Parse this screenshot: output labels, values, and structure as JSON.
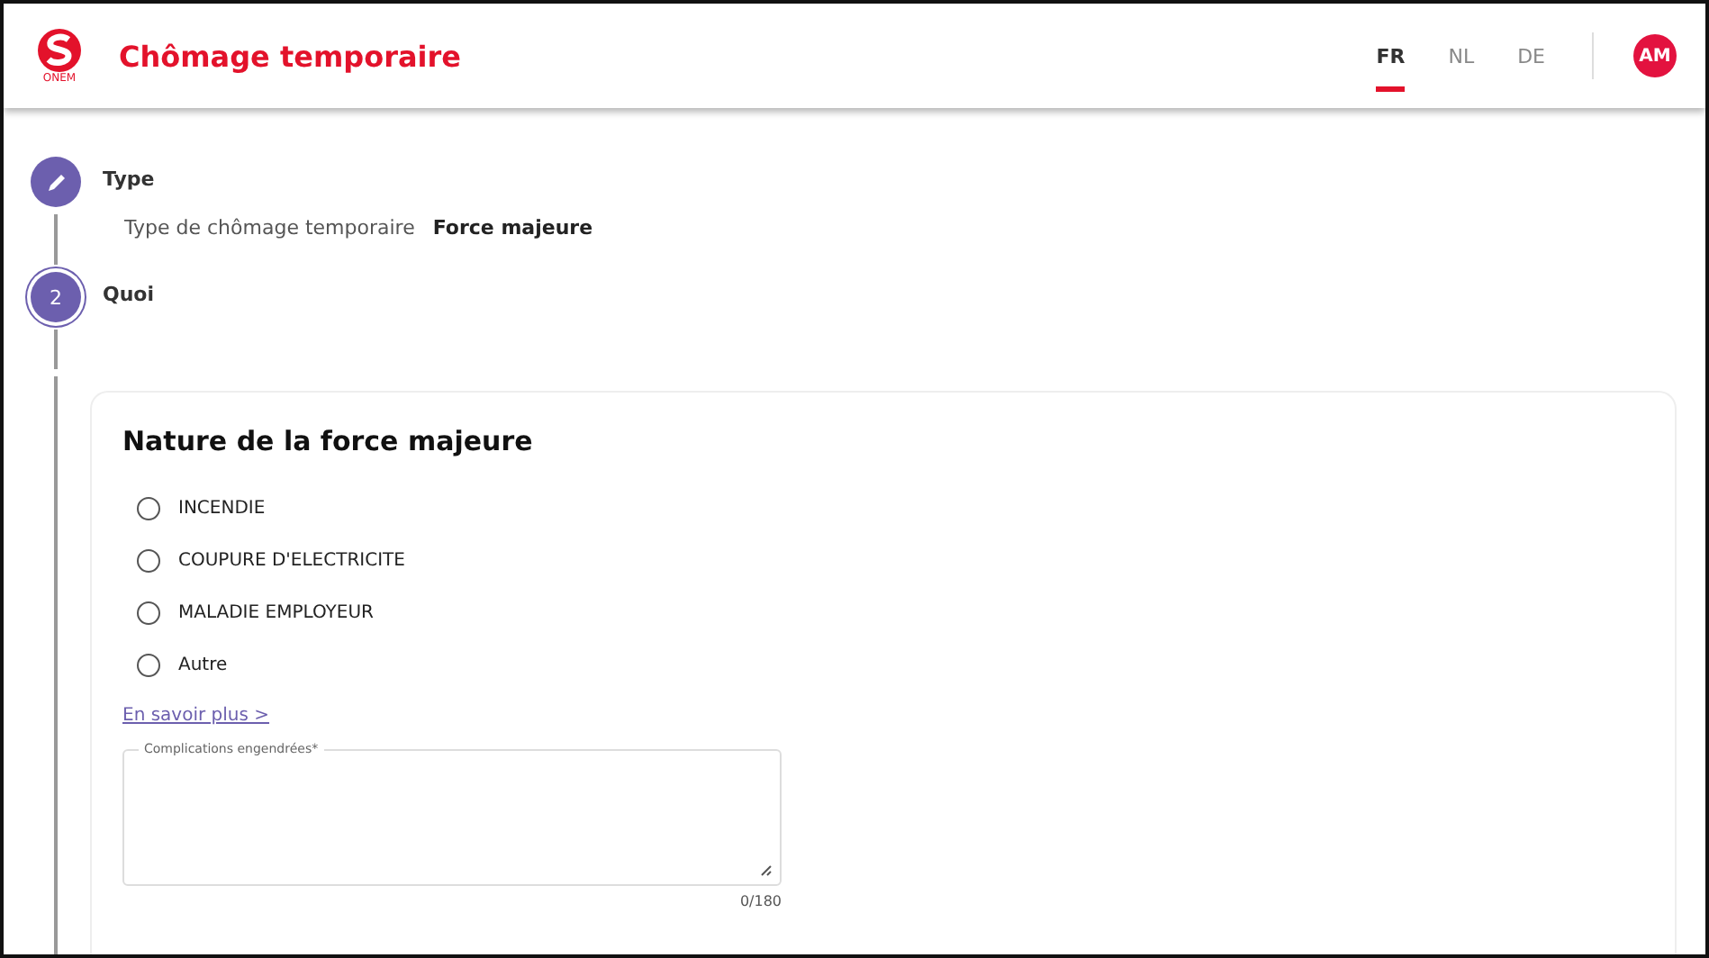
{
  "header": {
    "logo_text": "ONEM",
    "title": "Chômage temporaire",
    "languages": [
      {
        "label": "FR",
        "selected": true
      },
      {
        "label": "NL",
        "selected": false
      },
      {
        "label": "DE",
        "selected": false
      }
    ],
    "avatar": "AM"
  },
  "steps": [
    {
      "kind": "done",
      "title": "Type",
      "summary": {
        "label": "Type de chômage temporaire",
        "value": "Force majeure"
      }
    },
    {
      "kind": "current",
      "number": "2",
      "title": "Quoi"
    }
  ],
  "card": {
    "title": "Nature de la force majeure",
    "options": [
      {
        "label": "INCENDIE",
        "selected": false
      },
      {
        "label": "COUPURE D'ELECTRICITE",
        "selected": false
      },
      {
        "label": "MALADIE EMPLOYEUR",
        "selected": false
      },
      {
        "label": "Autre",
        "selected": false
      }
    ],
    "link": "En savoir plus >",
    "field": {
      "label": "Complications engendrées*",
      "counter": "0/180"
    }
  }
}
